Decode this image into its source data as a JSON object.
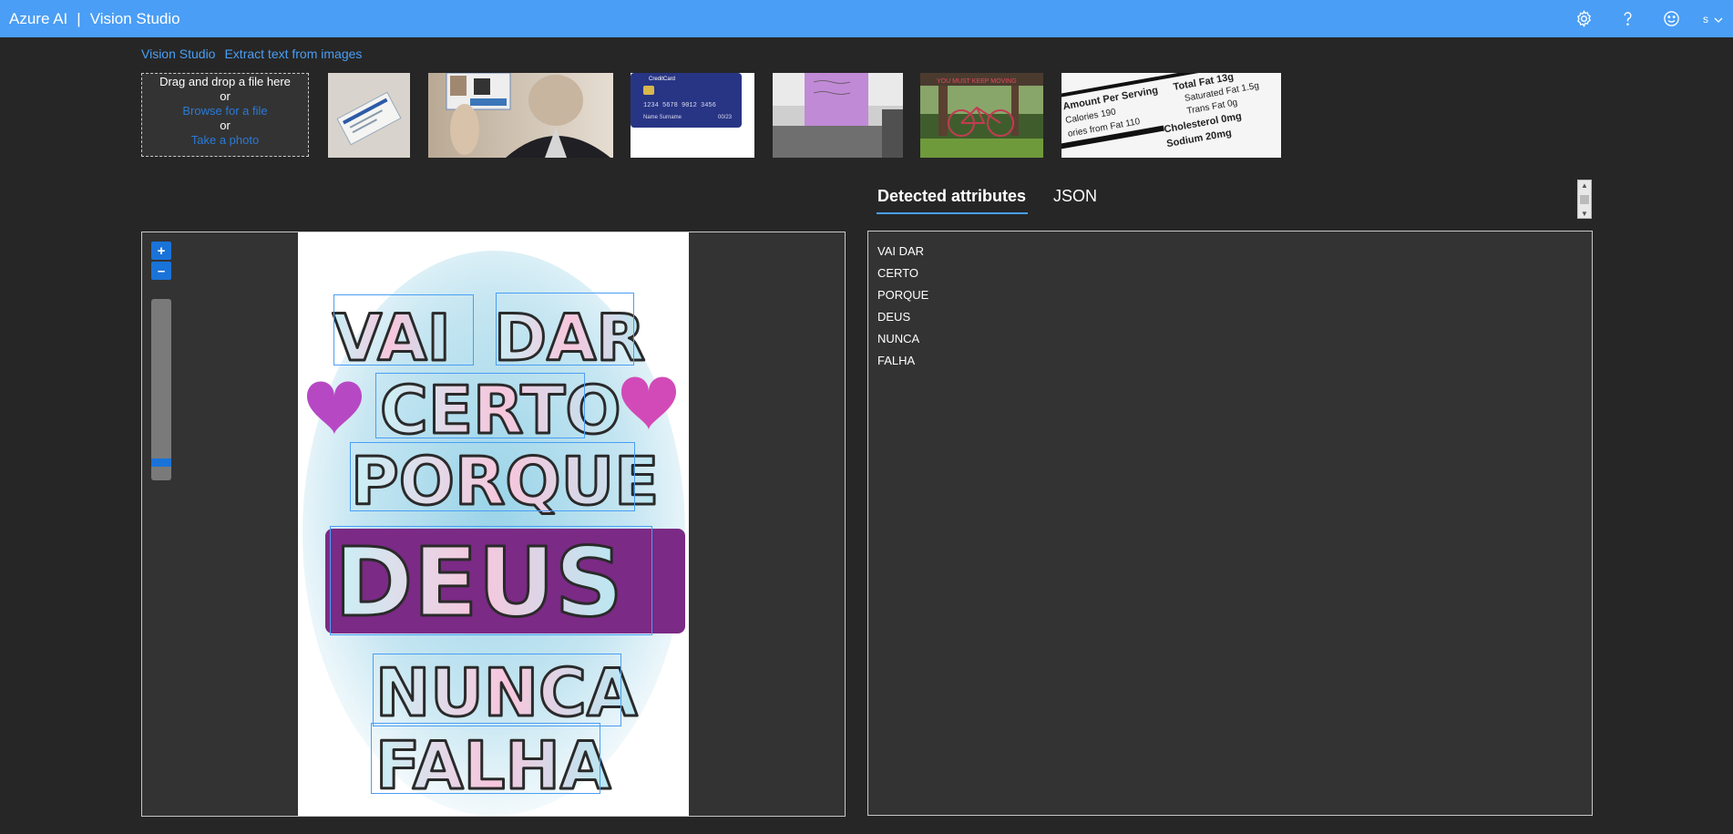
{
  "header": {
    "product": "Azure AI",
    "separator": "|",
    "app_name": "Vision Studio",
    "icons": [
      "gear-icon",
      "help-icon",
      "smiley-icon"
    ],
    "user_initial": "s"
  },
  "breadcrumb": {
    "root": "Vision Studio",
    "current": "Extract text from images"
  },
  "dropzone": {
    "line1": "Drag and drop a file here",
    "or1": "or",
    "browse": "Browse for a file",
    "or2": "or",
    "photo": "Take a photo"
  },
  "samples": {
    "card_text": "1234 5678 9012 3456",
    "card_name": "Name Surname",
    "card_date": "00/23",
    "card_brand": "CreditCard",
    "sign_text": "YOU MUST KEEP MOVING",
    "nutrition": [
      "Amount Per Serving",
      "Calories 190",
      "ories from Fat 110",
      "Total Fat 13g",
      "Saturated Fat 1.5g",
      "Trans Fat 0g",
      "Cholesterol 0mg",
      "Sodium 20mg"
    ]
  },
  "tabs": {
    "detected": "Detected attributes",
    "json": "JSON"
  },
  "zoom": {
    "in": "+",
    "out": "–",
    "level": 0.07
  },
  "image_words": [
    "VAI",
    "DAR",
    "CERTO",
    "PORQUE",
    "DEUS",
    "NUNCA",
    "FALHA"
  ],
  "results": [
    "VAI DAR",
    "CERTO",
    "PORQUE",
    "DEUS",
    "NUNCA",
    "FALHA"
  ],
  "colors": {
    "accent": "#4a9ef5",
    "background": "#262626",
    "panel": "#333333"
  }
}
